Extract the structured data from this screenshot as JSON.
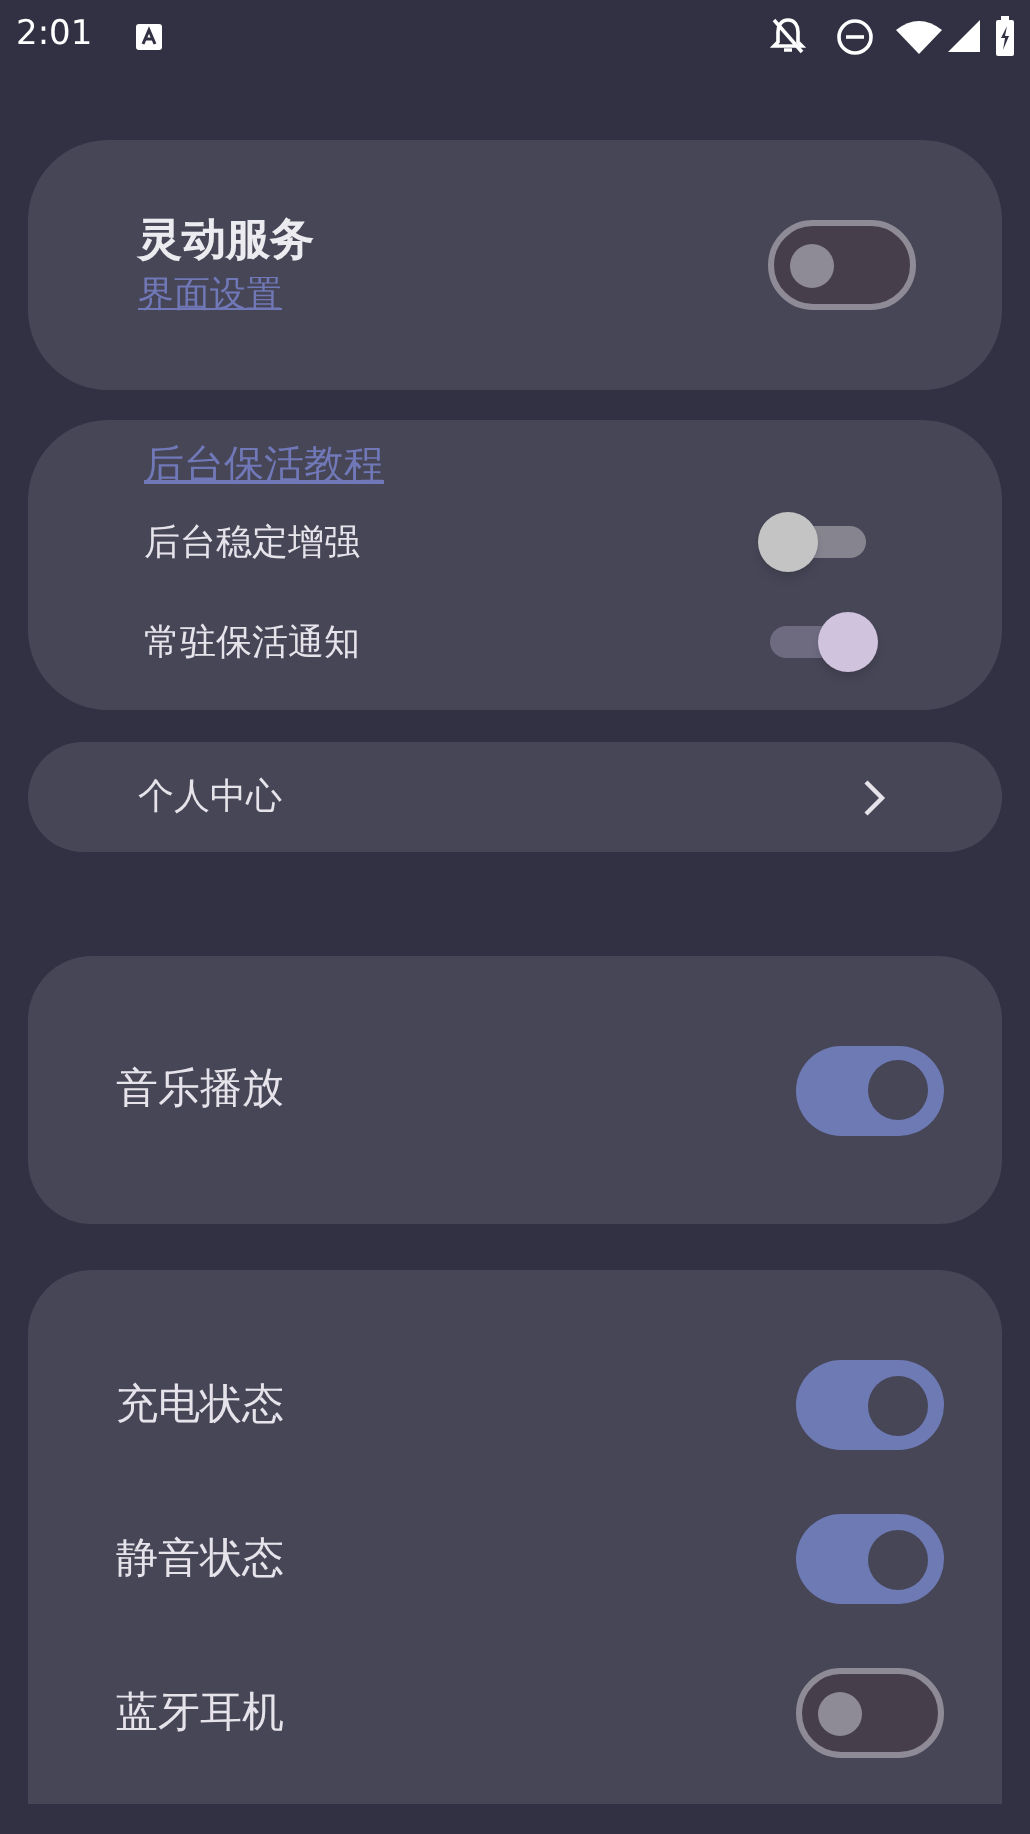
{
  "status_bar": {
    "time": "2:01"
  },
  "service_card": {
    "title": "灵动服务",
    "link": "界面设置",
    "switch": {
      "kind": "m3",
      "on": false
    }
  },
  "keepalive_card": {
    "link": "后台保活教程",
    "rows": [
      {
        "label": "后台稳定增强",
        "switch": {
          "kind": "compat",
          "on": false
        }
      },
      {
        "label": "常驻保活通知",
        "switch": {
          "kind": "compat",
          "on": true
        }
      }
    ]
  },
  "profile_row": {
    "label": "个人中心"
  },
  "music_card": {
    "rows": [
      {
        "label": "音乐播放",
        "switch": {
          "kind": "m3",
          "on": true
        }
      }
    ]
  },
  "status_card": {
    "rows": [
      {
        "label": "充电状态",
        "switch": {
          "kind": "m3",
          "on": true
        }
      },
      {
        "label": "静音状态",
        "switch": {
          "kind": "m3",
          "on": true
        }
      },
      {
        "label": "蓝牙耳机",
        "switch": {
          "kind": "m3",
          "on": false
        }
      }
    ]
  }
}
